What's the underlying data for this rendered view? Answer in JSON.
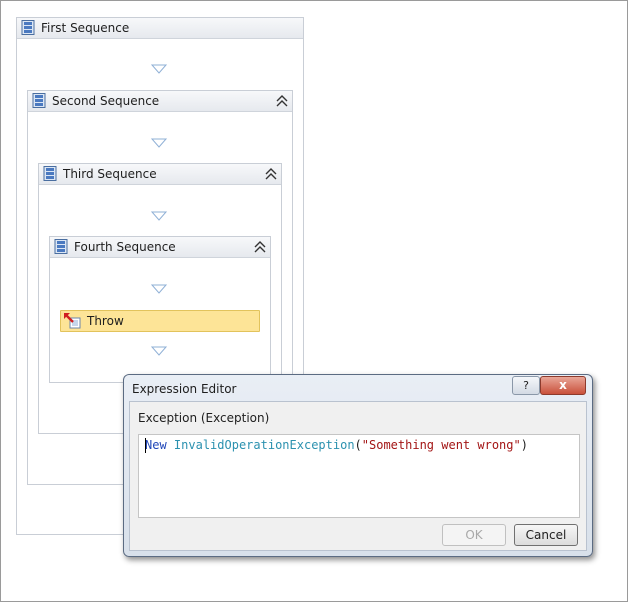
{
  "designer": {
    "sequences": [
      {
        "title": "First Sequence",
        "collapsible": false
      },
      {
        "title": "Second Sequence",
        "collapsible": true
      },
      {
        "title": "Third Sequence",
        "collapsible": true
      },
      {
        "title": "Fourth Sequence",
        "collapsible": true
      }
    ],
    "activity": {
      "label": "Throw"
    },
    "icons": {
      "sequence": "sequence-icon",
      "collapse": "double-chevron-up-icon",
      "drop": "drop-target-triangle-icon",
      "throw": "throw-activity-icon"
    }
  },
  "dialog": {
    "title": "Expression Editor",
    "help_label": "?",
    "close_label": "x",
    "field_label": "Exception (Exception)",
    "expression": {
      "keyword": "New",
      "type_name": "InvalidOperationException",
      "open_paren": "(",
      "string_literal": "\"Something went wrong\"",
      "close_paren": ")"
    },
    "ok_label": "OK",
    "ok_enabled": false,
    "cancel_label": "Cancel"
  },
  "colors": {
    "keyword": "#2046b8",
    "type": "#2b91af",
    "string": "#a31515",
    "activity_fill": "#fde497"
  }
}
